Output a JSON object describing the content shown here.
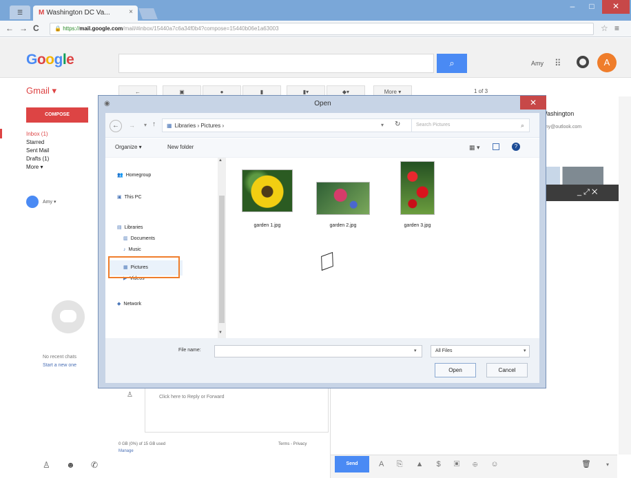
{
  "browser": {
    "tab_title": "Washington DC Va...",
    "tab_close": "×",
    "url_prefix": "https://",
    "url_domain": "mail.google.com",
    "url_path": "/mail/#inbox/15440a7c6a34f0b4?compose=15440b06e1a63003",
    "window_minimize": "–",
    "window_maximize": "□",
    "window_close": "✕",
    "nav_back": "←",
    "nav_forward": "→",
    "nav_reload": "C",
    "star_icon": "☆",
    "menu_icon": "≡"
  },
  "google": {
    "logo": "Google",
    "search_placeholder": "",
    "search_icon": "⌕",
    "user": "Amy",
    "apps_icon": "⠿",
    "avatar_letter": "A"
  },
  "gmail": {
    "label": "Gmail ▾",
    "compose": "COMPOSE",
    "folders": [
      {
        "label": "Inbox (1)",
        "active": true
      },
      {
        "label": "Starred",
        "active": false
      },
      {
        "label": "Sent Mail",
        "active": false
      },
      {
        "label": "Drafts (1)",
        "active": false
      },
      {
        "label": "More ▾",
        "active": false
      }
    ],
    "user_menu": "Amy ▾",
    "no_chats": "No recent chats",
    "start_chat": "Start a new one",
    "toolbar_buttons": [
      "←",
      "▣",
      "●",
      "▮",
      "▮▾",
      "◆▾",
      "More ▾"
    ],
    "pager": "1 of 3",
    "contact_name": "Washington",
    "contact_email": "amy@outlook.com",
    "compose_controls": "_ ⤢ ✕",
    "reply_hint": "Click here to Reply or Forward",
    "storage": "0 GB (0%) of 15 GB used",
    "manage": "Manage",
    "terms": "Terms - Privacy",
    "send": "Send",
    "send_icons": "A ⎘ ▲ $ ▣ ⊕ ☺",
    "trash_icon": "🗑",
    "more_icon": "▾",
    "footer_icons": "♙ ☻ ✆"
  },
  "dialog": {
    "title": "Open",
    "close": "✕",
    "path": "Libraries › Pictures ›",
    "search_placeholder": "Search Pictures",
    "organize": "Organize ▾",
    "new_folder": "New folder",
    "tree": [
      {
        "label": "Homegroup",
        "icon": "👥"
      },
      {
        "label": "This PC",
        "icon": "▣"
      },
      {
        "label": "Libraries",
        "icon": "▤"
      },
      {
        "label": "Documents",
        "icon": "▥"
      },
      {
        "label": "Music",
        "icon": "♪"
      },
      {
        "label": "Pictures",
        "icon": "▦"
      },
      {
        "label": "Videos",
        "icon": "▶"
      },
      {
        "label": "Network",
        "icon": "◆"
      }
    ],
    "files": [
      {
        "name": "garden 1.jpg"
      },
      {
        "name": "garden 2.jpg"
      },
      {
        "name": "garden 3.jpg"
      }
    ],
    "filename_label": "File name:",
    "filename_value": "",
    "filetype": "All Files",
    "open_button": "Open",
    "cancel_button": "Cancel"
  },
  "colors": {
    "accent_red": "#d44444",
    "google_blue": "#4a8af4",
    "highlight_orange": "#ef7d2b",
    "avatar_orange": "#ef7d2b"
  }
}
